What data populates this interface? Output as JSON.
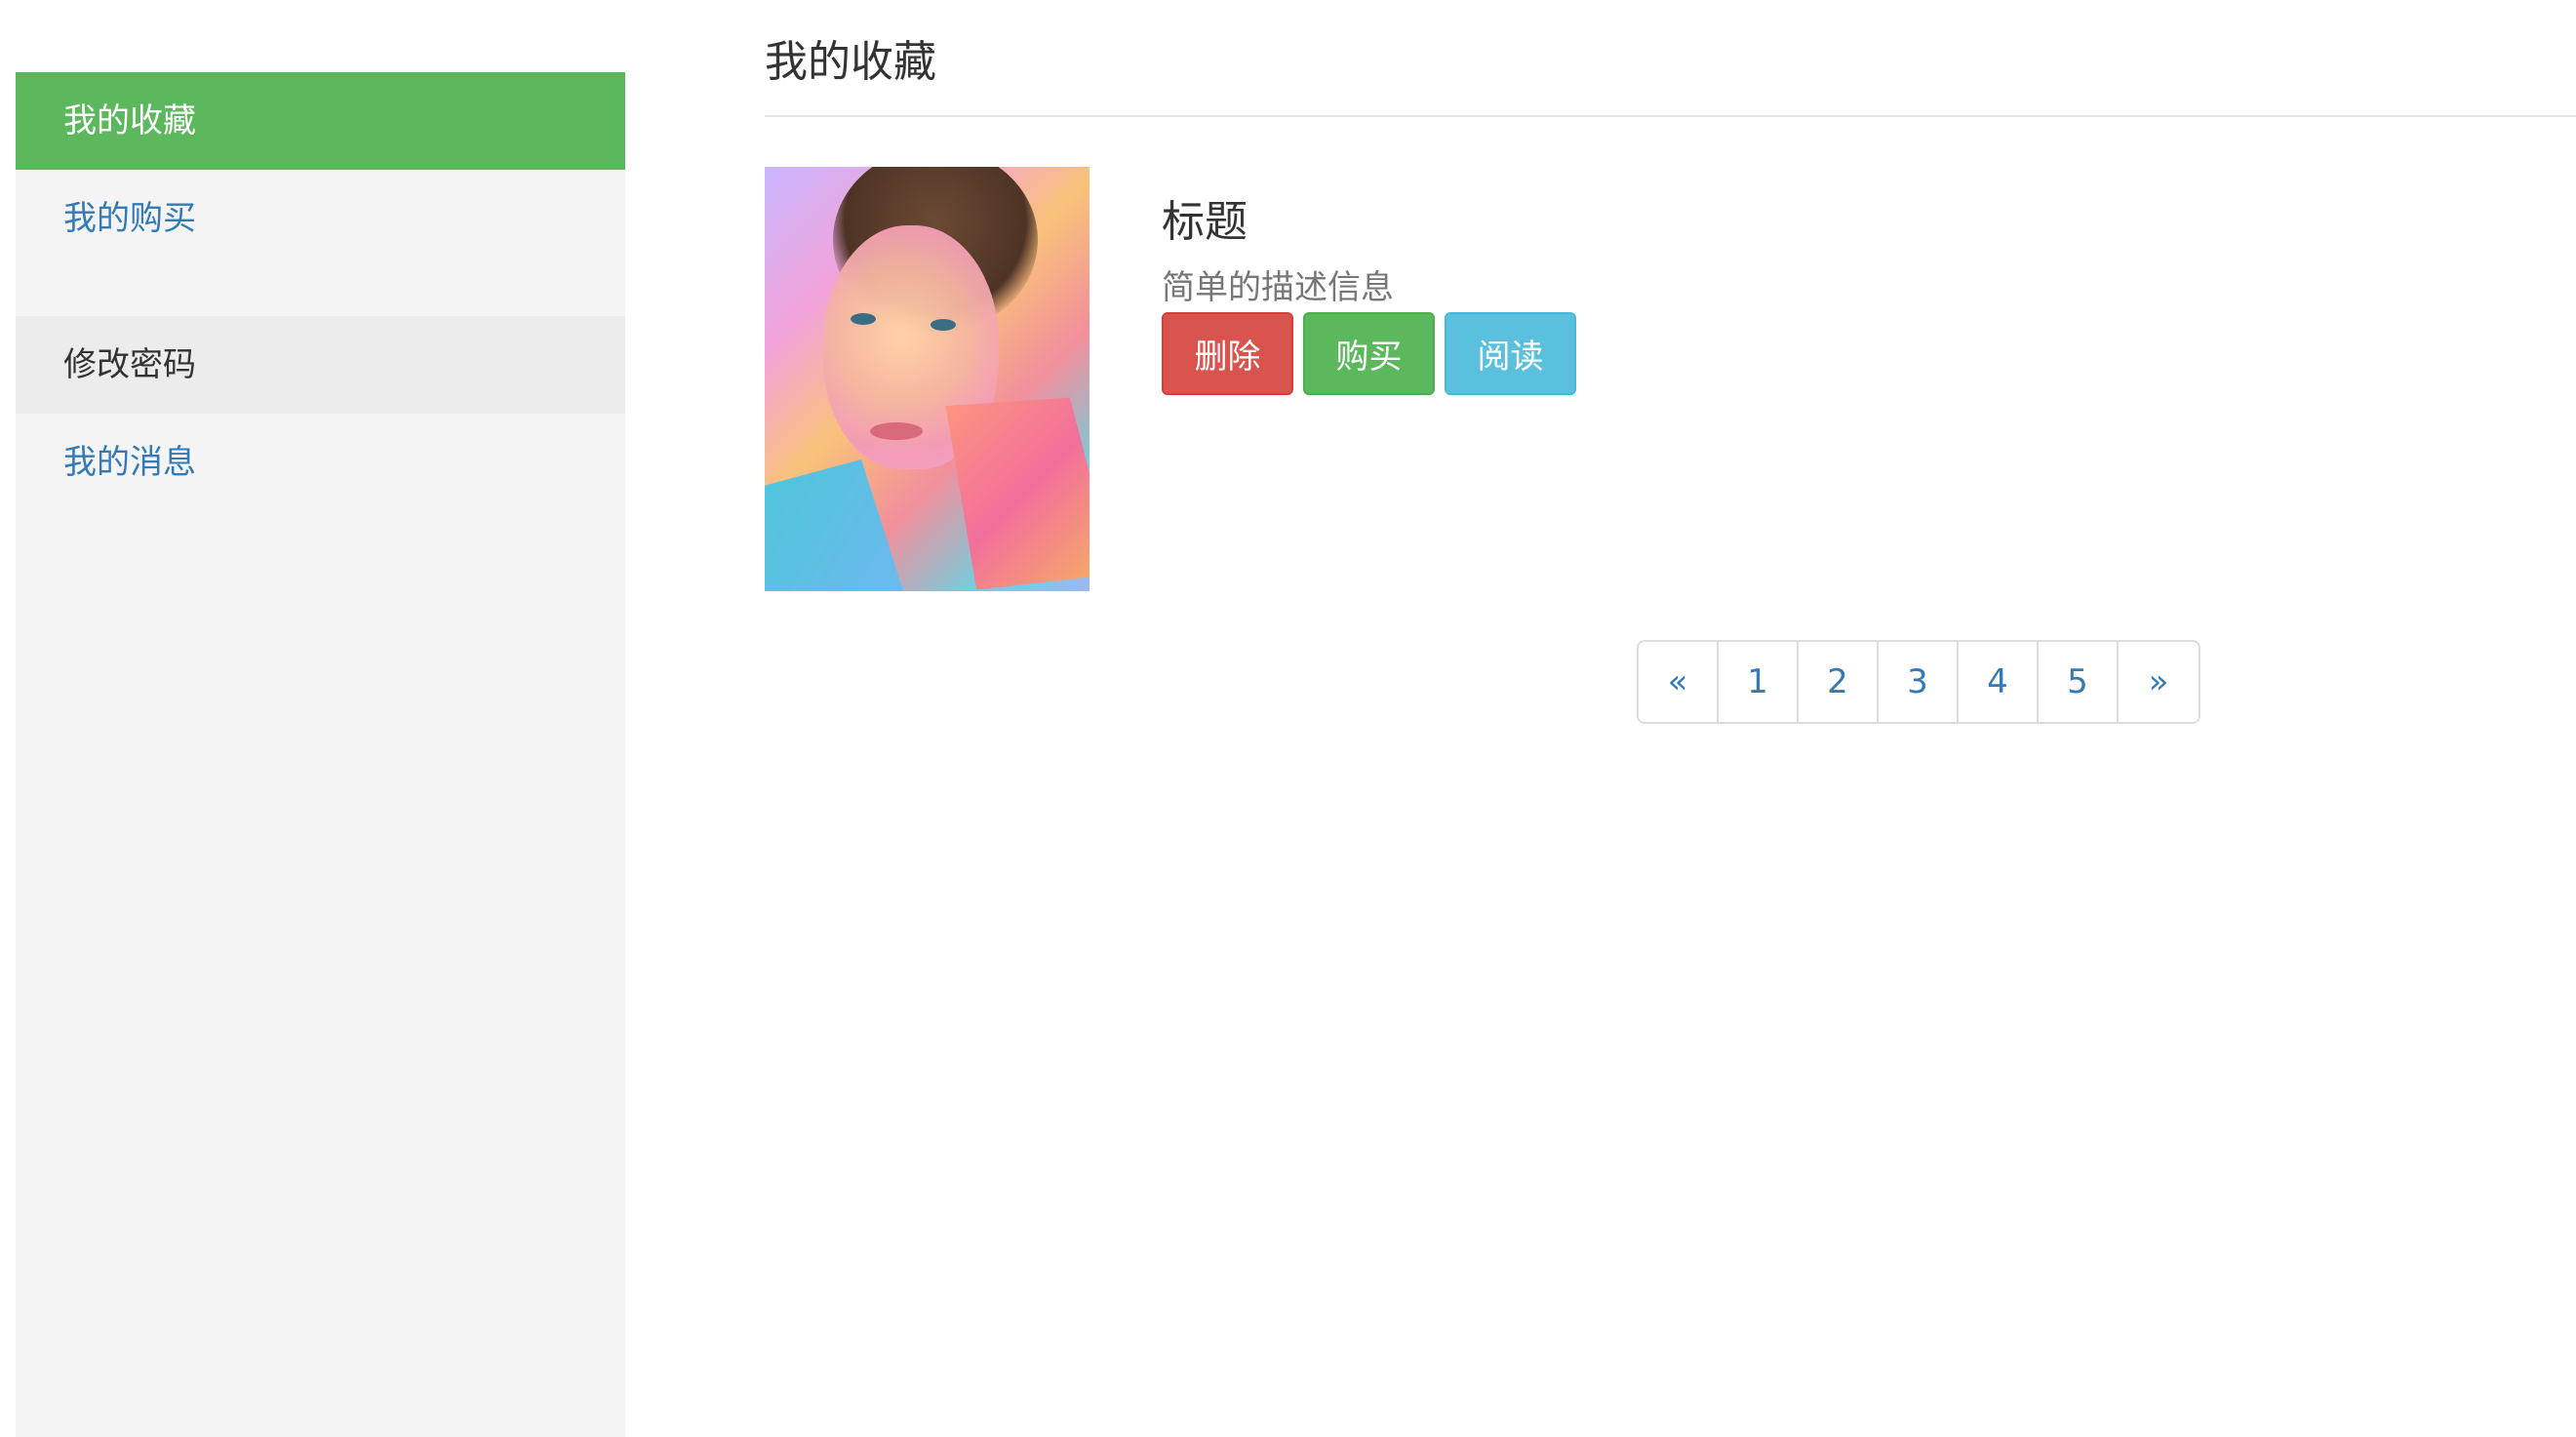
{
  "sidebar": {
    "items": [
      {
        "label": "我的收藏"
      },
      {
        "label": "我的购买"
      },
      {
        "label": "修改密码"
      },
      {
        "label": "我的消息"
      }
    ]
  },
  "main": {
    "title": "我的收藏",
    "card": {
      "title": "标题",
      "description": "简单的描述信息",
      "buttons": {
        "delete": "删除",
        "buy": "购买",
        "read": "阅读"
      }
    },
    "pagination": {
      "prev": "«",
      "pages": [
        "1",
        "2",
        "3",
        "4",
        "5"
      ],
      "next": "»"
    }
  },
  "colors": {
    "active_green": "#5cb85c",
    "link_blue": "#337ab7",
    "danger_red": "#d9534f",
    "info_blue": "#5bc0de"
  }
}
